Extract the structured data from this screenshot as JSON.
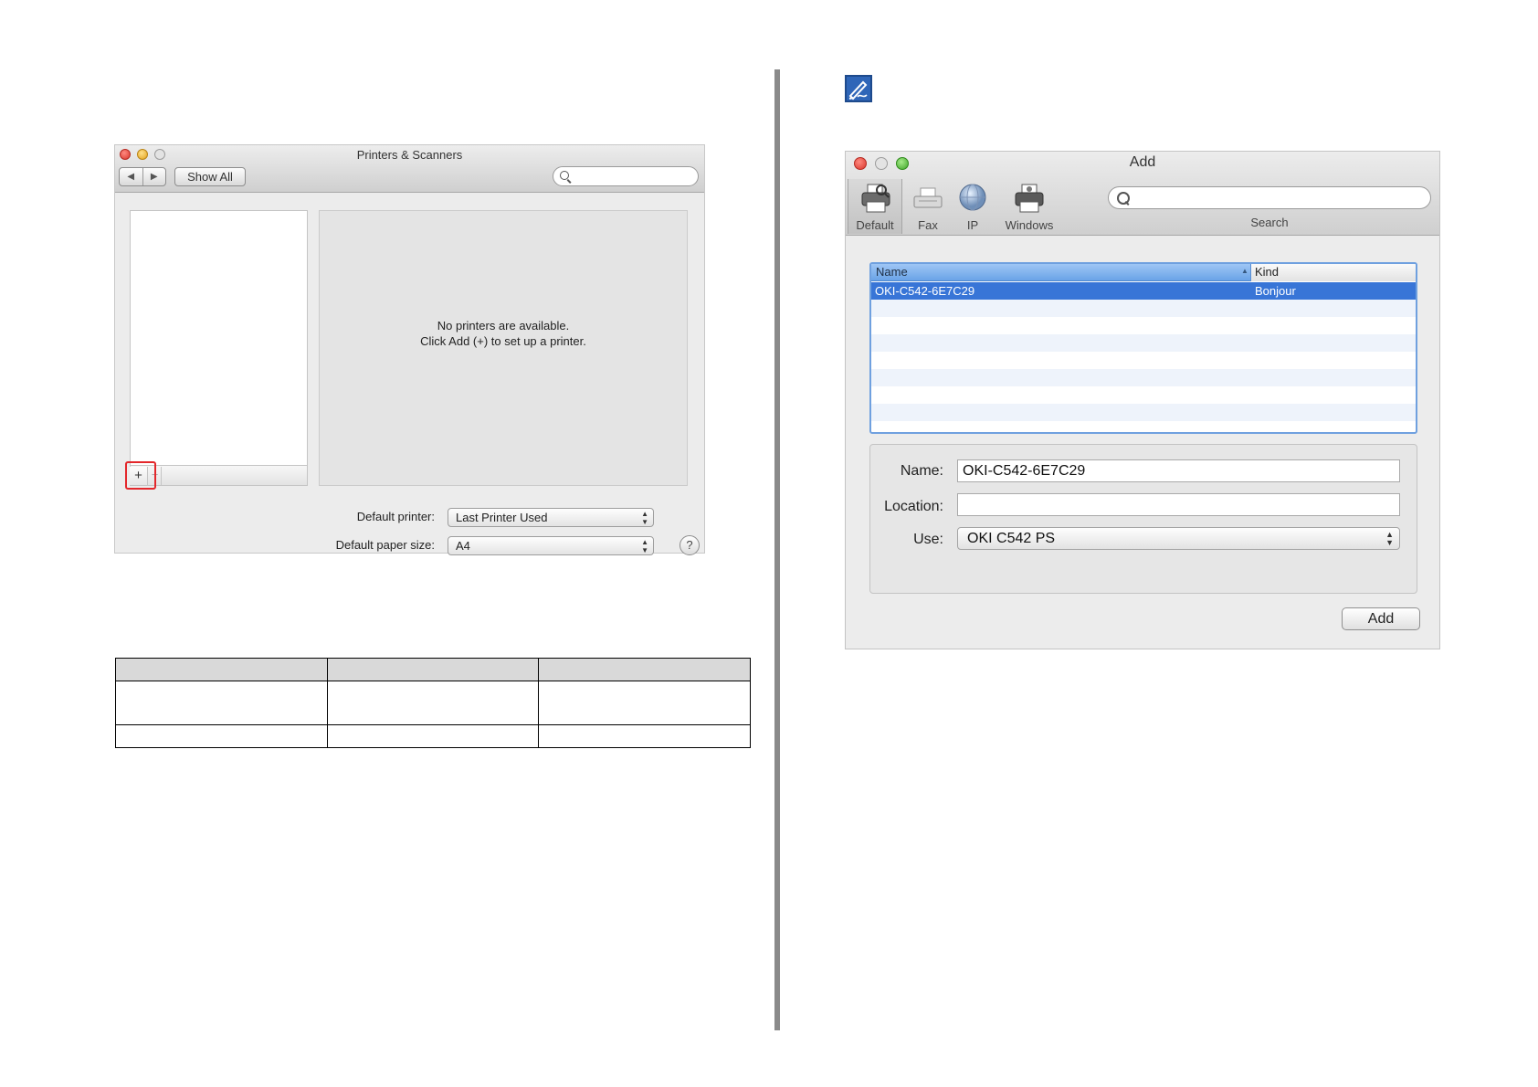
{
  "printers_window": {
    "title": "Printers & Scanners",
    "nav_back": "◀",
    "nav_forward": "▶",
    "show_all_label": "Show All",
    "search_placeholder": "",
    "empty_message_line1": "No printers are available.",
    "empty_message_line2": "Click Add (+) to set up a printer.",
    "add_button_label": "+",
    "remove_button_label": "−",
    "default_printer_label": "Default printer:",
    "default_printer_value": "Last Printer Used",
    "default_paper_label": "Default paper size:",
    "default_paper_value": "A4",
    "help_label": "?"
  },
  "table": {
    "rows": [
      [
        "",
        "",
        ""
      ],
      [
        "",
        "",
        ""
      ],
      [
        "",
        "",
        ""
      ]
    ]
  },
  "add_window": {
    "title": "Add",
    "toolbar": {
      "default_label": "Default",
      "fax_label": "Fax",
      "ip_label": "IP",
      "windows_label": "Windows",
      "search_label": "Search"
    },
    "printer_table": {
      "columns": [
        "Name",
        "Kind"
      ],
      "rows": [
        {
          "name": "OKI-C542-6E7C29",
          "kind": "Bonjour"
        }
      ]
    },
    "form": {
      "name_label": "Name:",
      "name_value": "OKI-C542-6E7C29",
      "location_label": "Location:",
      "location_value": "",
      "use_label": "Use:",
      "use_value": "OKI C542 PS"
    },
    "add_button_label": "Add"
  },
  "colors": {
    "highlight_box": "#e3272b",
    "selection": "#3875d7",
    "memo_icon": "#2f66b8"
  }
}
